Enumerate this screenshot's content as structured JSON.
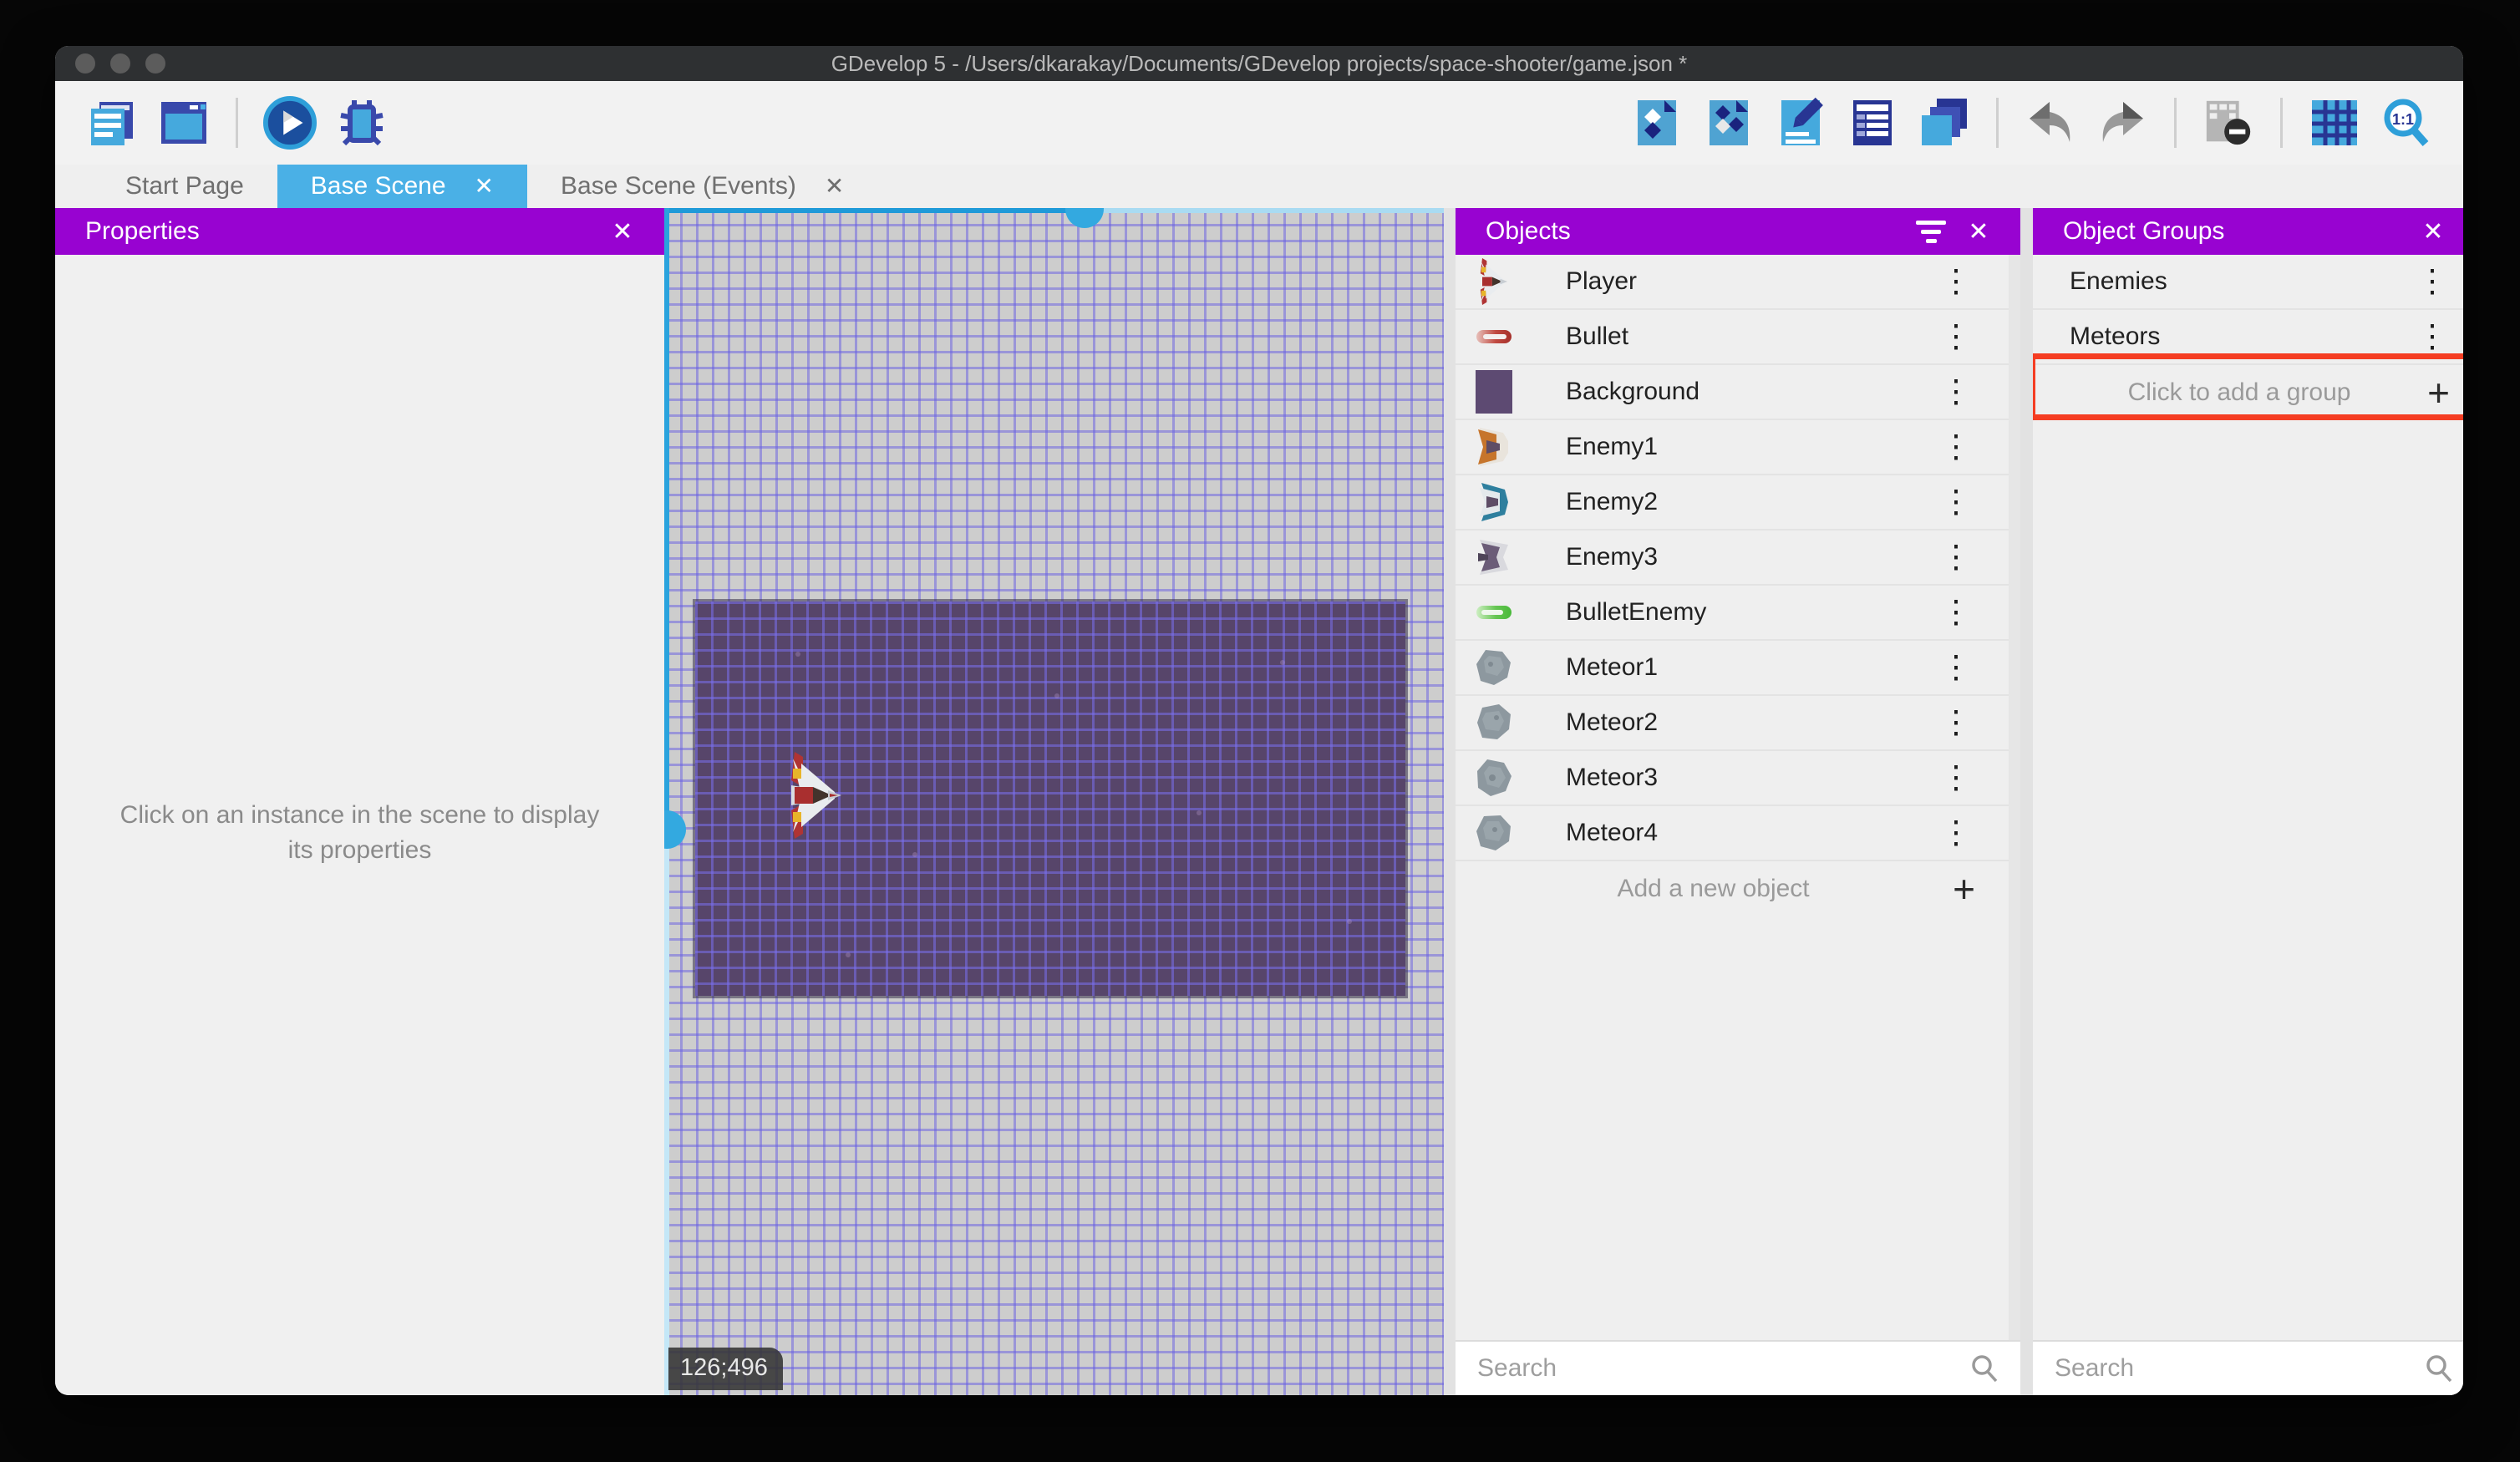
{
  "window": {
    "title": "GDevelop 5 - /Users/dkarakay/Documents/GDevelop projects/space-shooter/game.json *"
  },
  "toolbar": {
    "left_icons": [
      "project-manager-icon",
      "scene-window-icon",
      "play-icon",
      "debug-icon"
    ],
    "right_icons": [
      "objects-editor-icon",
      "object-groups-icon",
      "properties-pencil-icon",
      "instances-list-icon",
      "layers-icon",
      "undo-icon",
      "redo-icon",
      "mask-remove-icon",
      "grid-icon",
      "zoom-1-1-icon"
    ]
  },
  "tabs": [
    {
      "label": "Start Page",
      "active": false,
      "closable": false
    },
    {
      "label": "Base Scene",
      "active": true,
      "closable": true,
      "close_glyph": "✕"
    },
    {
      "label": "Base Scene (Events)",
      "active": false,
      "closable": true,
      "close_glyph": "✕"
    }
  ],
  "properties_panel": {
    "title": "Properties",
    "close_glyph": "✕",
    "empty_message": "Click on an instance in the scene to display its properties"
  },
  "scene": {
    "coordinates": "126;496"
  },
  "objects_panel": {
    "title": "Objects",
    "close_glyph": "✕",
    "kebab_glyph": "⋮",
    "items": [
      {
        "name": "Player",
        "icon": "player-ship-icon"
      },
      {
        "name": "Bullet",
        "icon": "red-bullet-icon"
      },
      {
        "name": "Background",
        "icon": "background-swatch-icon"
      },
      {
        "name": "Enemy1",
        "icon": "enemy1-ship-icon"
      },
      {
        "name": "Enemy2",
        "icon": "enemy2-ship-icon"
      },
      {
        "name": "Enemy3",
        "icon": "enemy3-ship-icon"
      },
      {
        "name": "BulletEnemy",
        "icon": "green-bullet-icon"
      },
      {
        "name": "Meteor1",
        "icon": "meteor-icon"
      },
      {
        "name": "Meteor2",
        "icon": "meteor-icon"
      },
      {
        "name": "Meteor3",
        "icon": "meteor-icon"
      },
      {
        "name": "Meteor4",
        "icon": "meteor-icon"
      }
    ],
    "add_label": "Add a new object",
    "add_glyph": "+",
    "search_placeholder": "Search"
  },
  "object_groups_panel": {
    "title": "Object Groups",
    "close_glyph": "✕",
    "kebab_glyph": "⋮",
    "groups": [
      {
        "name": "Enemies",
        "highlighted": false
      },
      {
        "name": "Meteors",
        "highlighted": true
      }
    ],
    "add_label": "Click to add a group",
    "add_glyph": "+",
    "search_placeholder": "Search"
  },
  "colors": {
    "panel_header": "#9803d1",
    "active_tab": "#4ab0e6",
    "highlight_annotation": "#f53d22",
    "canvas_background": "#57456a",
    "titlebar": "#2e3032"
  }
}
